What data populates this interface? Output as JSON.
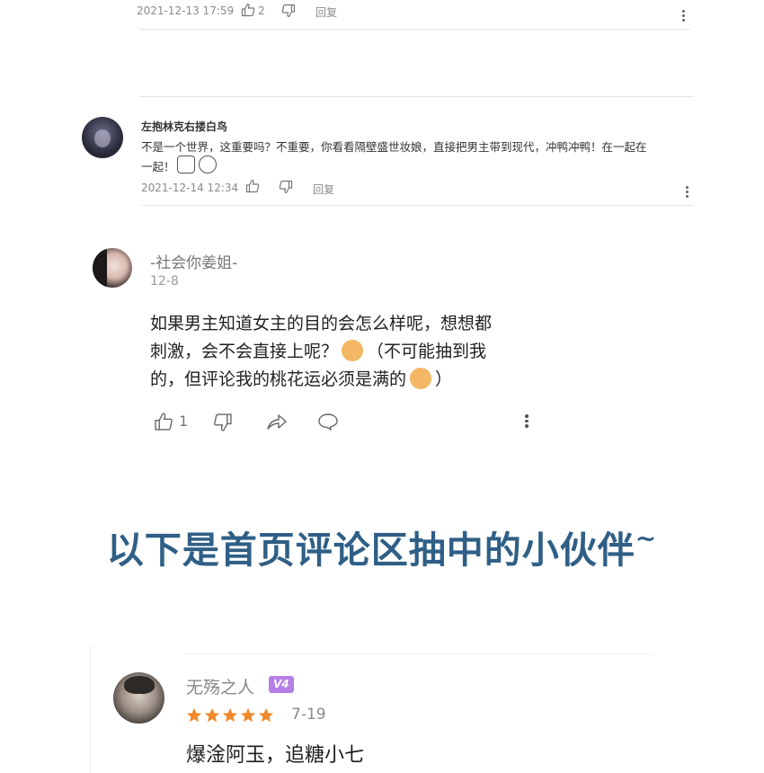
{
  "comment1": {
    "timestamp": "2021-12-13 17:59",
    "like_count": "2",
    "reply_label": "回复"
  },
  "comment2": {
    "username": "左抱林克右搂白鸟",
    "text_line1": "不是一个世界，这重要吗？不重要，你看看隔壁盛世妆娘，直接把男主带到现代，冲鸭冲鸭！在一起在",
    "text_line2": "一起！",
    "timestamp": "2021-12-14 12:34",
    "reply_label": "回复"
  },
  "comment3": {
    "username": "-社会你姜姐-",
    "date": "12-8",
    "text_line1": "如果男主知道女主的目的会怎么样呢，想想都",
    "text_line2a": "刺激，会不会直接上呢？",
    "text_line2b": "（不可能抽到我",
    "text_line3a": "的，但评论我的桃花运必须是满的",
    "text_line3b": "）",
    "like_count": "1"
  },
  "headline": {
    "text": "以下是首页评论区抽中的小伙伴",
    "tilde": "~"
  },
  "comment4": {
    "username": "无殇之人",
    "badge": "V4",
    "rating_stars": 5,
    "date": "7-19",
    "text": "爆淦阿玉，追糖小七"
  },
  "colors": {
    "headline": "#2f5f86",
    "meta_gray": "#8a8a8a",
    "star_orange": "#f08a2c",
    "badge_purple": "#b77ee5"
  },
  "icons": [
    "thumbs-up-icon",
    "thumbs-down-icon",
    "reply-link",
    "share-icon",
    "comment-icon",
    "more-icon",
    "star-icon"
  ]
}
